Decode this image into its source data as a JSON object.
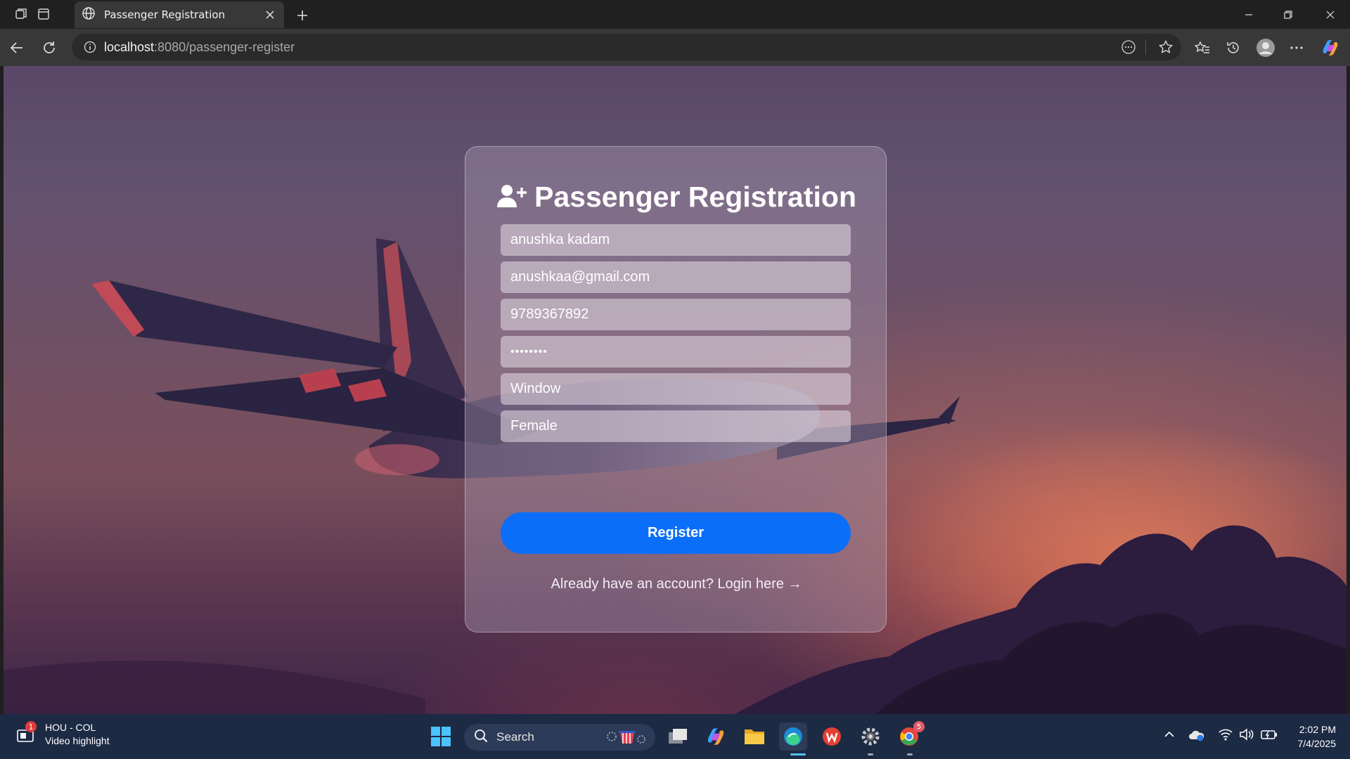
{
  "browser": {
    "tab_title": "Passenger Registration",
    "address_host": "localhost",
    "address_path": ":8080/passenger-register"
  },
  "page": {
    "heading": "Passenger Registration",
    "fields": {
      "name": "anushka kadam",
      "email": "anushkaa@gmail.com",
      "phone": "9789367892",
      "password_mask": "••••••••",
      "seat_preference": "Window",
      "gender": "Female"
    },
    "register_label": "Register",
    "login_prompt": "Already have an account? Login here →",
    "accent_color": "#0b6ef9"
  },
  "taskbar": {
    "news_badge": "1",
    "news_title": "HOU - COL",
    "news_subtitle": "Video highlight",
    "search_label": "Search",
    "chrome_badge": "5",
    "time": "2:02 PM",
    "date": "7/4/2025"
  }
}
